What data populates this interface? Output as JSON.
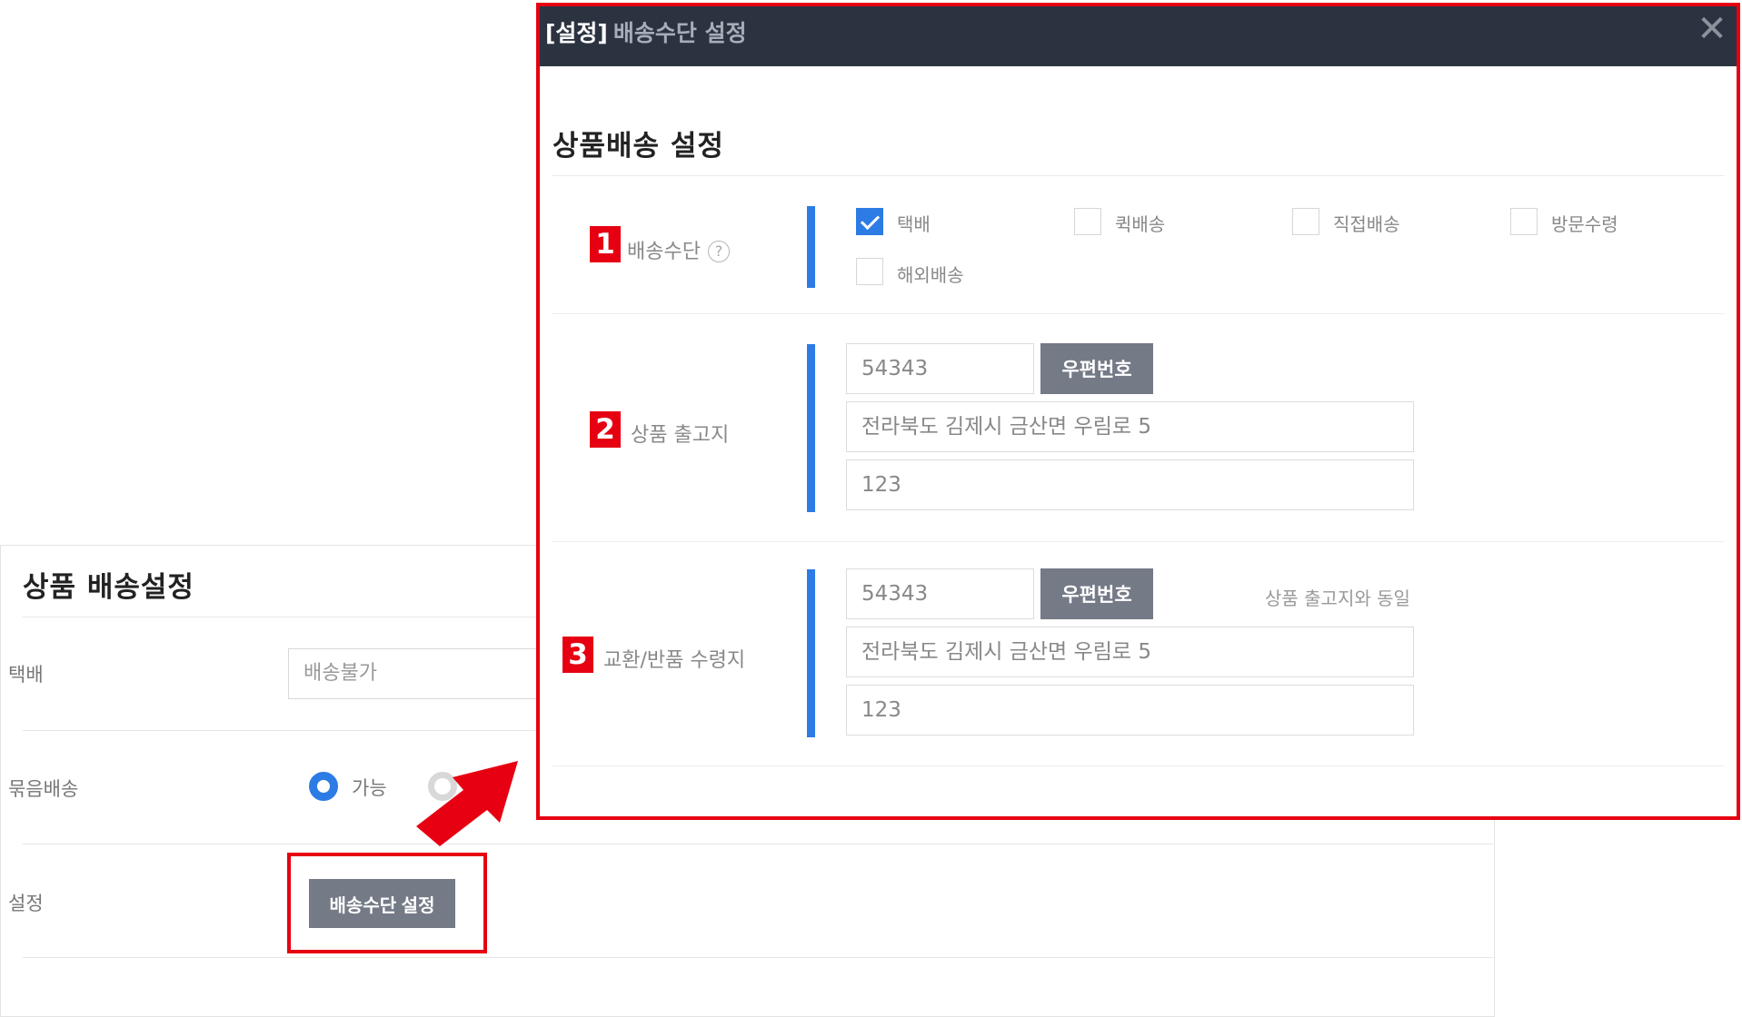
{
  "background": {
    "title": "상품 배송설정",
    "rows": {
      "courier_label": "택배",
      "courier_value": "배송불가",
      "bundle_label": "묶음배송",
      "bundle_option_yes": "가능",
      "settings_label": "설정",
      "settings_button": "배송수단 설정"
    }
  },
  "modal": {
    "title_bracket": "[설정]",
    "title_rest": "배송수단 설정",
    "close_icon": "✕",
    "section_title": "상품배송 설정",
    "rows": [
      {
        "num": "1",
        "label": "배송수단",
        "help_icon": "?",
        "options": [
          {
            "label": "택배",
            "checked": true
          },
          {
            "label": "퀵배송",
            "checked": false
          },
          {
            "label": "직접배송",
            "checked": false
          },
          {
            "label": "방문수령",
            "checked": false
          },
          {
            "label": "해외배송",
            "checked": false
          }
        ]
      },
      {
        "num": "2",
        "label": "상품 출고지",
        "zip": "54343",
        "zip_button": "우편번호",
        "address1": "전라북도 김제시 금산면 우림로 5",
        "address2": "123"
      },
      {
        "num": "3",
        "label": "교환/반품 수령지",
        "zip": "54343",
        "zip_button": "우편번호",
        "same_as": "상품 출고지와 동일",
        "address1": "전라북도 김제시 금산면 우림로 5",
        "address2": "123"
      }
    ]
  },
  "colors": {
    "accent_blue": "#2d7be5",
    "highlight_red": "#e60012",
    "header_dark": "#2c3340",
    "button_gray": "#747a86"
  }
}
